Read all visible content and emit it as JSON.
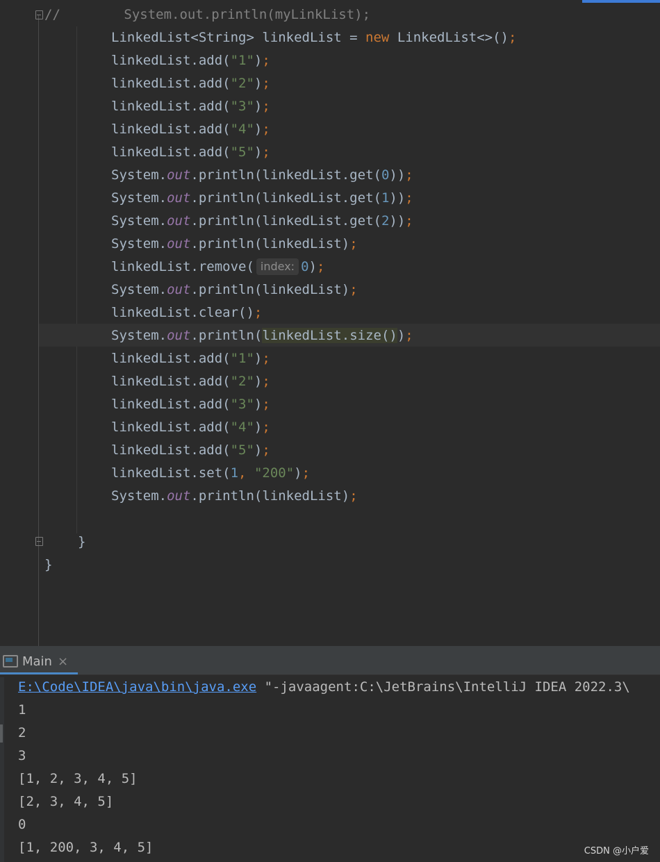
{
  "editor": {
    "lines": [
      {
        "prefix": "//",
        "text": "        System.out.println(myLinkList);"
      },
      {
        "text": "LinkedList<String> linkedList = new LinkedList<>();"
      },
      {
        "text": "linkedList.add(\"1\");"
      },
      {
        "text": "linkedList.add(\"2\");"
      },
      {
        "text": "linkedList.add(\"3\");"
      },
      {
        "text": "linkedList.add(\"4\");"
      },
      {
        "text": "linkedList.add(\"5\");"
      },
      {
        "text": "System.out.println(linkedList.get(0));"
      },
      {
        "text": "System.out.println(linkedList.get(1));"
      },
      {
        "text": "System.out.println(linkedList.get(2));"
      },
      {
        "text": "System.out.println(linkedList);"
      },
      {
        "text": "linkedList.remove(0);",
        "hint": "index:"
      },
      {
        "text": "System.out.println(linkedList);"
      },
      {
        "text": "linkedList.clear();"
      },
      {
        "text": "System.out.println(linkedList.size());"
      },
      {
        "text": "linkedList.add(\"1\");"
      },
      {
        "text": "linkedList.add(\"2\");"
      },
      {
        "text": "linkedList.add(\"3\");"
      },
      {
        "text": "linkedList.add(\"4\");"
      },
      {
        "text": "linkedList.add(\"5\");"
      },
      {
        "text": "linkedList.set(1, \"200\");"
      },
      {
        "text": "System.out.println(linkedList);"
      },
      {
        "text": ""
      },
      {
        "text": "}"
      },
      {
        "text": "}"
      }
    ]
  },
  "run_panel": {
    "tab_label": "Main",
    "command_path": "E:\\Code\\IDEA\\java\\bin\\java.exe",
    "command_args": " \"-javaagent:C:\\JetBrains\\IntelliJ IDEA 2022.3\\",
    "output": [
      "1",
      "2",
      "3",
      "[1, 2, 3, 4, 5]",
      "[2, 3, 4, 5]",
      "0",
      "[1, 200, 3, 4, 5]"
    ]
  },
  "watermark": "CSDN @小户爱",
  "colors": {
    "background": "#2b2b2b",
    "keyword": "#cc7832",
    "string": "#6a8759",
    "number": "#6897bb",
    "field": "#9876aa",
    "default_text": "#a9b7c6",
    "link": "#589df6"
  }
}
